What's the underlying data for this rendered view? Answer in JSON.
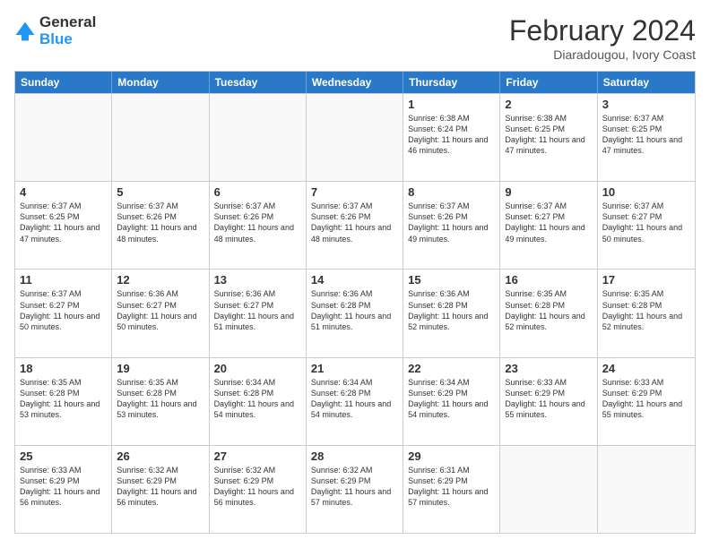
{
  "header": {
    "logo_line1": "General",
    "logo_line2": "Blue",
    "main_title": "February 2024",
    "subtitle": "Diaradougou, Ivory Coast"
  },
  "days_of_week": [
    "Sunday",
    "Monday",
    "Tuesday",
    "Wednesday",
    "Thursday",
    "Friday",
    "Saturday"
  ],
  "weeks": [
    [
      {
        "day": "",
        "empty": true
      },
      {
        "day": "",
        "empty": true
      },
      {
        "day": "",
        "empty": true
      },
      {
        "day": "",
        "empty": true
      },
      {
        "day": "1",
        "sunrise": "6:38 AM",
        "sunset": "6:24 PM",
        "daylight": "11 hours and 46 minutes."
      },
      {
        "day": "2",
        "sunrise": "6:38 AM",
        "sunset": "6:25 PM",
        "daylight": "11 hours and 47 minutes."
      },
      {
        "day": "3",
        "sunrise": "6:37 AM",
        "sunset": "6:25 PM",
        "daylight": "11 hours and 47 minutes."
      }
    ],
    [
      {
        "day": "4",
        "sunrise": "6:37 AM",
        "sunset": "6:25 PM",
        "daylight": "11 hours and 47 minutes."
      },
      {
        "day": "5",
        "sunrise": "6:37 AM",
        "sunset": "6:26 PM",
        "daylight": "11 hours and 48 minutes."
      },
      {
        "day": "6",
        "sunrise": "6:37 AM",
        "sunset": "6:26 PM",
        "daylight": "11 hours and 48 minutes."
      },
      {
        "day": "7",
        "sunrise": "6:37 AM",
        "sunset": "6:26 PM",
        "daylight": "11 hours and 48 minutes."
      },
      {
        "day": "8",
        "sunrise": "6:37 AM",
        "sunset": "6:26 PM",
        "daylight": "11 hours and 49 minutes."
      },
      {
        "day": "9",
        "sunrise": "6:37 AM",
        "sunset": "6:27 PM",
        "daylight": "11 hours and 49 minutes."
      },
      {
        "day": "10",
        "sunrise": "6:37 AM",
        "sunset": "6:27 PM",
        "daylight": "11 hours and 50 minutes."
      }
    ],
    [
      {
        "day": "11",
        "sunrise": "6:37 AM",
        "sunset": "6:27 PM",
        "daylight": "11 hours and 50 minutes."
      },
      {
        "day": "12",
        "sunrise": "6:36 AM",
        "sunset": "6:27 PM",
        "daylight": "11 hours and 50 minutes."
      },
      {
        "day": "13",
        "sunrise": "6:36 AM",
        "sunset": "6:27 PM",
        "daylight": "11 hours and 51 minutes."
      },
      {
        "day": "14",
        "sunrise": "6:36 AM",
        "sunset": "6:28 PM",
        "daylight": "11 hours and 51 minutes."
      },
      {
        "day": "15",
        "sunrise": "6:36 AM",
        "sunset": "6:28 PM",
        "daylight": "11 hours and 52 minutes."
      },
      {
        "day": "16",
        "sunrise": "6:35 AM",
        "sunset": "6:28 PM",
        "daylight": "11 hours and 52 minutes."
      },
      {
        "day": "17",
        "sunrise": "6:35 AM",
        "sunset": "6:28 PM",
        "daylight": "11 hours and 52 minutes."
      }
    ],
    [
      {
        "day": "18",
        "sunrise": "6:35 AM",
        "sunset": "6:28 PM",
        "daylight": "11 hours and 53 minutes."
      },
      {
        "day": "19",
        "sunrise": "6:35 AM",
        "sunset": "6:28 PM",
        "daylight": "11 hours and 53 minutes."
      },
      {
        "day": "20",
        "sunrise": "6:34 AM",
        "sunset": "6:28 PM",
        "daylight": "11 hours and 54 minutes."
      },
      {
        "day": "21",
        "sunrise": "6:34 AM",
        "sunset": "6:28 PM",
        "daylight": "11 hours and 54 minutes."
      },
      {
        "day": "22",
        "sunrise": "6:34 AM",
        "sunset": "6:29 PM",
        "daylight": "11 hours and 54 minutes."
      },
      {
        "day": "23",
        "sunrise": "6:33 AM",
        "sunset": "6:29 PM",
        "daylight": "11 hours and 55 minutes."
      },
      {
        "day": "24",
        "sunrise": "6:33 AM",
        "sunset": "6:29 PM",
        "daylight": "11 hours and 55 minutes."
      }
    ],
    [
      {
        "day": "25",
        "sunrise": "6:33 AM",
        "sunset": "6:29 PM",
        "daylight": "11 hours and 56 minutes."
      },
      {
        "day": "26",
        "sunrise": "6:32 AM",
        "sunset": "6:29 PM",
        "daylight": "11 hours and 56 minutes."
      },
      {
        "day": "27",
        "sunrise": "6:32 AM",
        "sunset": "6:29 PM",
        "daylight": "11 hours and 56 minutes."
      },
      {
        "day": "28",
        "sunrise": "6:32 AM",
        "sunset": "6:29 PM",
        "daylight": "11 hours and 57 minutes."
      },
      {
        "day": "29",
        "sunrise": "6:31 AM",
        "sunset": "6:29 PM",
        "daylight": "11 hours and 57 minutes."
      },
      {
        "day": "",
        "empty": true
      },
      {
        "day": "",
        "empty": true
      }
    ]
  ]
}
